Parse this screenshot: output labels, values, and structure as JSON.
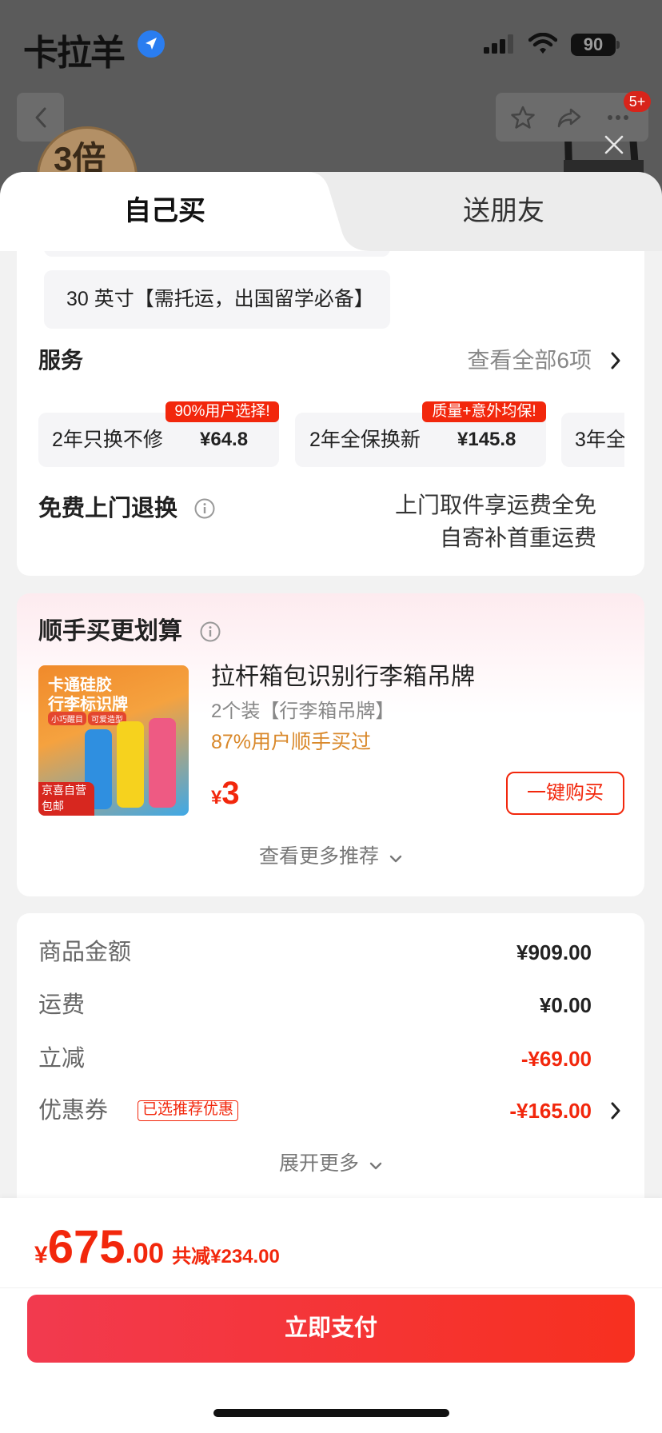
{
  "status_bar": {
    "logo": "卡拉羊",
    "battery": "90"
  },
  "background": {
    "promo_badge": "3倍",
    "notification_count": "5+"
  },
  "tabs": [
    {
      "label": "自己买",
      "active": true
    },
    {
      "label": "送朋友",
      "active": false
    }
  ],
  "specs": {
    "selected_option": "30 英寸【需托运，出国留学必备】"
  },
  "services": {
    "title": "服务",
    "view_all": "查看全部6项",
    "items": [
      {
        "name": "2年只换不修",
        "price": "¥64.8",
        "badge": "90%用户选择!"
      },
      {
        "name": "2年全保换新",
        "price": "¥145.8",
        "badge": "质量+意外均保!"
      },
      {
        "name": "3年全"
      }
    ]
  },
  "free_return": {
    "title": "免费上门退换",
    "line1": "上门取件享运费全免",
    "line2": "自寄补首重运费"
  },
  "addon": {
    "title": "顺手买更划算",
    "product": {
      "title": "拉杆箱包识别行李箱吊牌",
      "subtitle": "2个装【行李箱吊牌】",
      "social_proof": "87%用户顺手买过",
      "currency": "¥",
      "price": "3",
      "buy_button": "一键购买",
      "image_text": {
        "line1": "卡通硅胶",
        "line2": "行李标识牌",
        "chip1": "小巧醒目",
        "chip2": "可爱造型",
        "corner1": "京喜自营",
        "corner2": "包邮"
      }
    },
    "more": "查看更多推荐"
  },
  "summary": {
    "rows": [
      {
        "label": "商品金额",
        "value": "¥909.00"
      },
      {
        "label": "运费",
        "value": "¥0.00"
      },
      {
        "label": "立减",
        "value": "-¥69.00"
      },
      {
        "label": "优惠券",
        "tag": "已选推荐优惠",
        "value": "-¥165.00"
      }
    ],
    "expand": "展开更多"
  },
  "footer": {
    "currency": "¥",
    "amount_int": "675",
    "amount_dec": ".00",
    "total_discount": "共减¥234.00",
    "pay_button": "立即支付"
  },
  "colors": {
    "accent_red": "#f2270c",
    "orange": "#d9882a",
    "pay_gradient_start": "#f23a4f",
    "pay_gradient_end": "#f7301f"
  },
  "icons": [
    "location-icon",
    "signal-icon",
    "wifi-icon",
    "battery-icon",
    "back-icon",
    "star-icon",
    "share-icon",
    "more-icon",
    "close-icon",
    "info-icon",
    "chevron-right-icon",
    "chevron-down-icon"
  ]
}
